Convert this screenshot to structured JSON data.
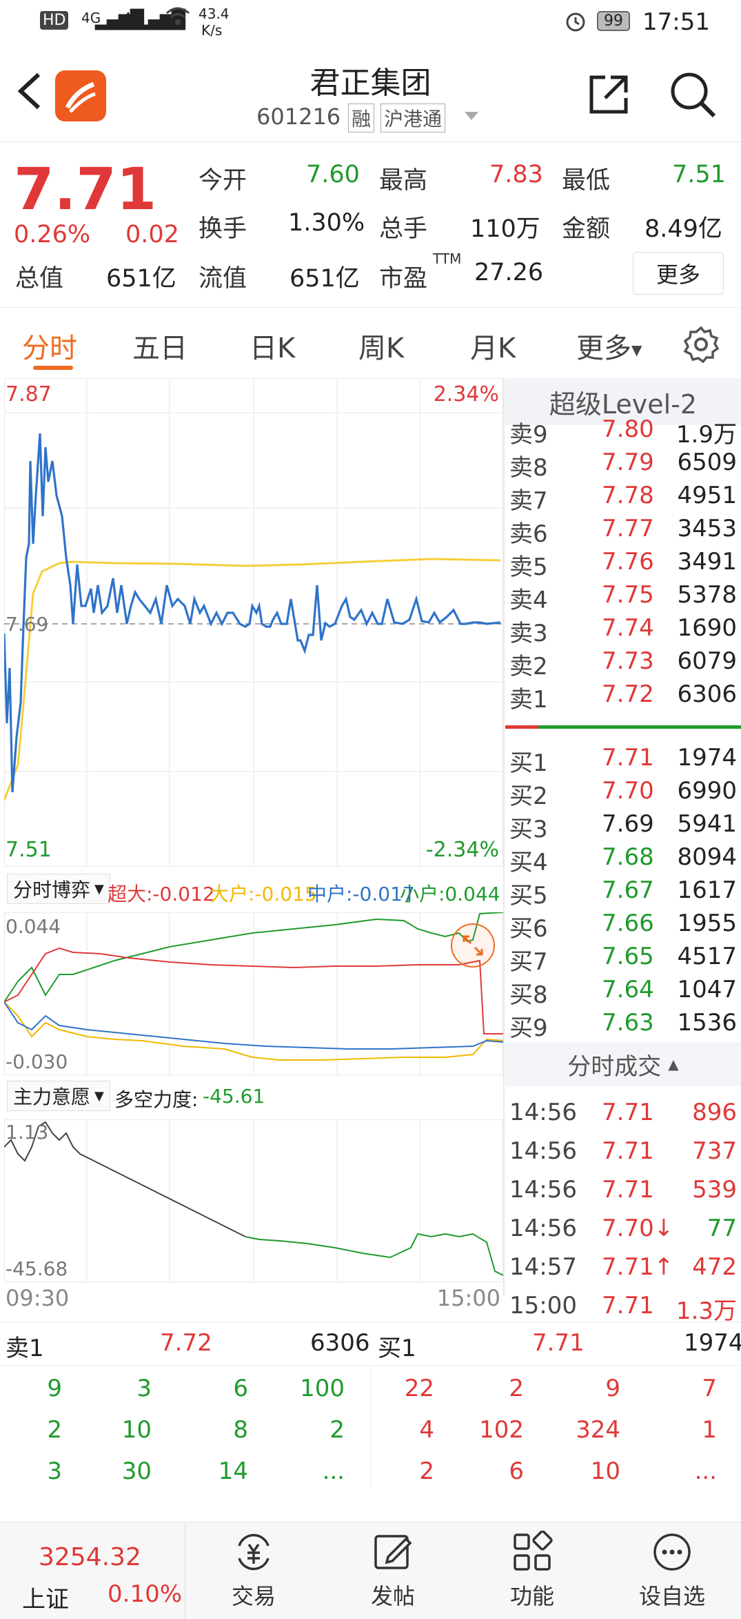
{
  "status_bar": {
    "hd": "HD",
    "net1": "4G",
    "net2": "4G",
    "speed_val": "43.4",
    "speed_unit": "K/s",
    "battery": "99",
    "time": "17:51"
  },
  "header": {
    "title": "君正集团",
    "code": "601216",
    "tag1": "融",
    "tag2": "沪港通"
  },
  "quote": {
    "price": "7.71",
    "change_pct": "0.26%",
    "change": "0.02",
    "open_label": "今开",
    "open": "7.60",
    "high_label": "最高",
    "high": "7.83",
    "low_label": "最低",
    "low": "7.51",
    "turnover_label": "换手",
    "turnover": "1.30%",
    "vol_label": "总手",
    "vol": "110万",
    "amount_label": "金额",
    "amount": "8.49亿",
    "mcap_label": "总值",
    "mcap": "651亿",
    "float_label": "流值",
    "float": "651亿",
    "pe_label": "市盈",
    "pe_sup": "TTM",
    "pe": "27.26",
    "more": "更多"
  },
  "tabs": [
    "分时",
    "五日",
    "日K",
    "周K",
    "月K",
    "更多"
  ],
  "intraday": {
    "top_price": "7.87",
    "top_pct": "2.34%",
    "mid_price": "7.69",
    "bot_price": "7.51",
    "bot_pct": "-2.34%",
    "time_start": "09:30",
    "time_end": "15:00"
  },
  "panel1": {
    "selector": "分时博弈",
    "super": "超大:-0.012",
    "big": "大户:-0.015",
    "mid": "中户:-0.017",
    "small": "小户:0.044",
    "top": "0.044",
    "bottom": "-0.030"
  },
  "panel2": {
    "selector": "主力意愿",
    "force_label": "多空力度:",
    "force": "-45.61",
    "top": "1.13",
    "bottom": "-45.68"
  },
  "orderbook": {
    "title": "超级Level-2",
    "sell": [
      {
        "label": "卖9",
        "price": "7.80",
        "vol": "1.9万"
      },
      {
        "label": "卖8",
        "price": "7.79",
        "vol": "6509"
      },
      {
        "label": "卖7",
        "price": "7.78",
        "vol": "4951"
      },
      {
        "label": "卖6",
        "price": "7.77",
        "vol": "3453"
      },
      {
        "label": "卖5",
        "price": "7.76",
        "vol": "3491"
      },
      {
        "label": "卖4",
        "price": "7.75",
        "vol": "5378"
      },
      {
        "label": "卖3",
        "price": "7.74",
        "vol": "1690"
      },
      {
        "label": "卖2",
        "price": "7.73",
        "vol": "6079"
      },
      {
        "label": "卖1",
        "price": "7.72",
        "vol": "6306"
      }
    ],
    "buy": [
      {
        "label": "买1",
        "price": "7.71",
        "vol": "1974"
      },
      {
        "label": "买2",
        "price": "7.70",
        "vol": "6990"
      },
      {
        "label": "买3",
        "price": "7.69",
        "vol": "5941"
      },
      {
        "label": "买4",
        "price": "7.68",
        "vol": "8094"
      },
      {
        "label": "买5",
        "price": "7.67",
        "vol": "1617"
      },
      {
        "label": "买6",
        "price": "7.66",
        "vol": "1955"
      },
      {
        "label": "买7",
        "price": "7.65",
        "vol": "4517"
      },
      {
        "label": "买8",
        "price": "7.64",
        "vol": "1047"
      },
      {
        "label": "买9",
        "price": "7.63",
        "vol": "1536"
      }
    ]
  },
  "trades": {
    "title": "分时成交",
    "rows": [
      {
        "t": "14:56",
        "p": "7.71",
        "v": "896"
      },
      {
        "t": "14:56",
        "p": "7.71",
        "v": "737"
      },
      {
        "t": "14:56",
        "p": "7.71",
        "v": "539"
      },
      {
        "t": "14:56",
        "p": "7.70↓",
        "v": "77"
      },
      {
        "t": "14:57",
        "p": "7.71↑",
        "v": "472"
      },
      {
        "t": "15:00",
        "p": "7.71",
        "v": "1.3万"
      }
    ]
  },
  "depth": {
    "sell_label": "卖1",
    "sell_price": "7.72",
    "sell_vol": "6306",
    "buy_label": "买1",
    "buy_price": "7.71",
    "buy_vol": "1974",
    "sell_q": [
      [
        "9",
        "3",
        "6",
        "100"
      ],
      [
        "2",
        "10",
        "8",
        "2"
      ],
      [
        "3",
        "30",
        "14",
        "..."
      ]
    ],
    "buy_q": [
      [
        "22",
        "2",
        "9",
        "7"
      ],
      [
        "4",
        "102",
        "324",
        "1"
      ],
      [
        "2",
        "6",
        "10",
        "..."
      ]
    ]
  },
  "nav": {
    "index_value": "3254.32",
    "index_name": "上证",
    "index_pct": "0.10%",
    "items": [
      "交易",
      "发帖",
      "功能",
      "设自选"
    ]
  },
  "colors": {
    "up": "#e03838",
    "down": "#1f9a2c",
    "accent": "#ef6b1f",
    "price_line": "#2f73c9",
    "avg_line": "#f5cf3b"
  }
}
